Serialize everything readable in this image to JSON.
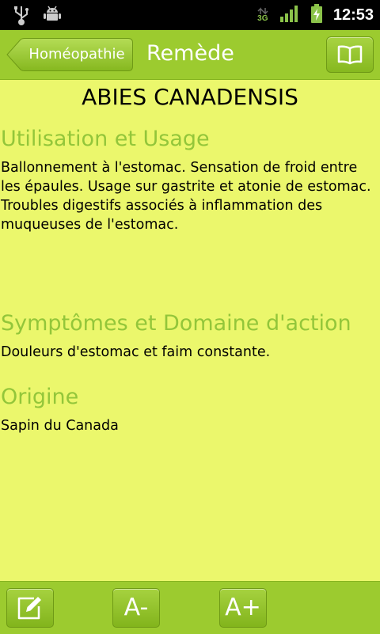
{
  "status_bar": {
    "time": "12:53",
    "network": "3G",
    "icons": [
      "usb-icon",
      "android-debug-icon",
      "data-transfer-icon",
      "signal-icon",
      "battery-charging-icon"
    ]
  },
  "title_bar": {
    "back_label": "Homéopathie",
    "title": "Remède",
    "action_icon": "book-icon"
  },
  "remedy": {
    "name": "ABIES CANADENSIS",
    "sections": [
      {
        "title": "Utilisation et Usage",
        "text": "Ballonnement à l'estomac. Sensation de froid entre les épaules. Usage sur gastrite et atonie de estomac. Troubles digestifs associés à inflammation des muqueuses de l'estomac."
      },
      {
        "title": "Symptômes et Domaine d'action",
        "text": "Douleurs d'estomac et faim constante."
      },
      {
        "title": "Origine",
        "text": "Sapin du Canada"
      }
    ]
  },
  "toolbar": {
    "edit_icon": "edit-icon",
    "decrease_label": "A-",
    "increase_label": "A+"
  },
  "colors": {
    "background": "#ebf76c",
    "bar": "#9ccb2f",
    "section_title": "#93c63a"
  }
}
